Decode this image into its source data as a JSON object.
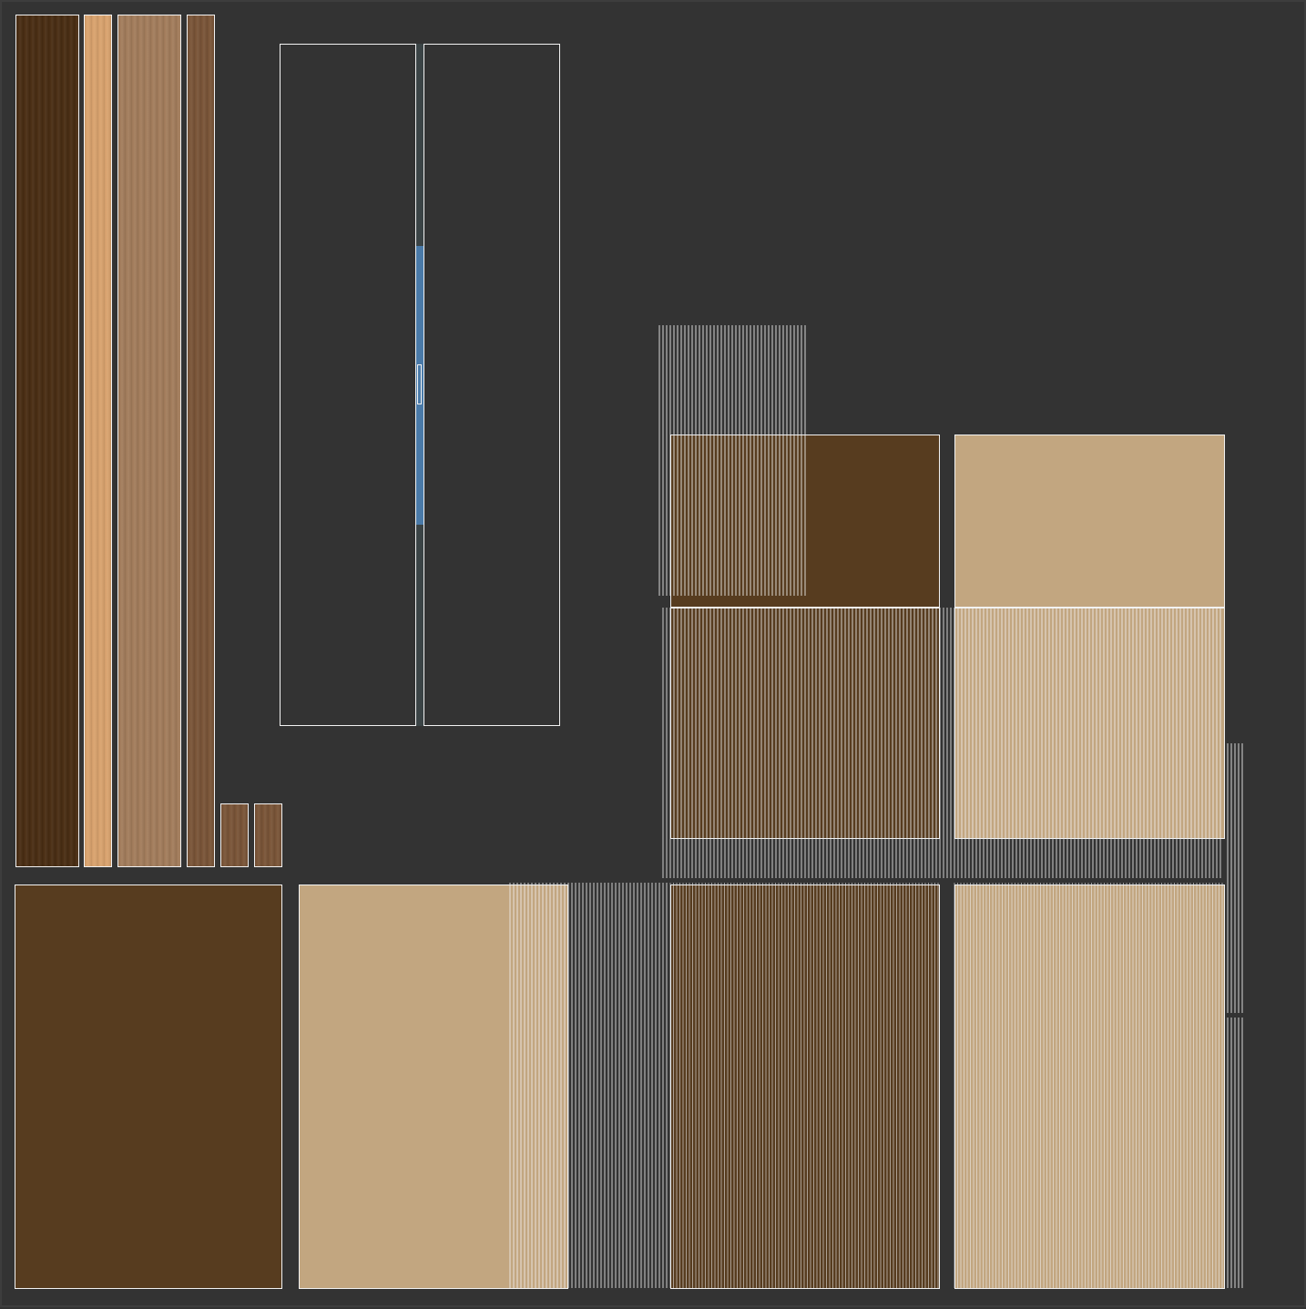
{
  "colors": {
    "background": "#333333",
    "wireframe": "#f2f2f2",
    "dark_wood": "#4a2e14",
    "light_wood": "#d9a36e",
    "medium_wood": "#a37d5c",
    "walnut": "#7a5538",
    "brown_panel": "#573c1f",
    "beige_panel": "#c2a680",
    "door_seam": "#4a7aa8"
  },
  "islands": [
    {
      "name": "uv-island-dark-wood-strip",
      "material": "dark_wood",
      "texture": "wood-grain"
    },
    {
      "name": "uv-island-light-wood-strip",
      "material": "light_wood",
      "texture": "wood-grain"
    },
    {
      "name": "uv-island-medium-wood-strip",
      "material": "medium_wood",
      "texture": "wood-grain"
    },
    {
      "name": "uv-island-walnut-strip",
      "material": "walnut",
      "texture": "wood-grain"
    },
    {
      "name": "uv-island-small-tile-a",
      "material": "walnut",
      "texture": "wood-grain"
    },
    {
      "name": "uv-island-small-tile-b",
      "material": "walnut",
      "texture": "wood-grain"
    },
    {
      "name": "uv-island-brown-panel-bottom-left",
      "material": "brown_panel",
      "texture": "flat"
    },
    {
      "name": "uv-island-beige-panel-bottom",
      "material": "beige_panel",
      "texture": "flat"
    },
    {
      "name": "uv-island-brown-panel-top",
      "material": "brown_panel",
      "texture": "flat"
    },
    {
      "name": "uv-island-beige-panel-top",
      "material": "beige_panel",
      "texture": "flat"
    },
    {
      "name": "uv-island-brown-panel-middle",
      "material": "brown_panel",
      "texture": "flat"
    },
    {
      "name": "uv-island-beige-panel-middle",
      "material": "beige_panel",
      "texture": "flat"
    },
    {
      "name": "uv-island-brown-panel-lower",
      "material": "brown_panel",
      "texture": "flat"
    },
    {
      "name": "uv-island-beige-panel-lower",
      "material": "beige_panel",
      "texture": "flat"
    },
    {
      "name": "uv-island-door-outline",
      "material": "none",
      "texture": "wireframe"
    }
  ]
}
